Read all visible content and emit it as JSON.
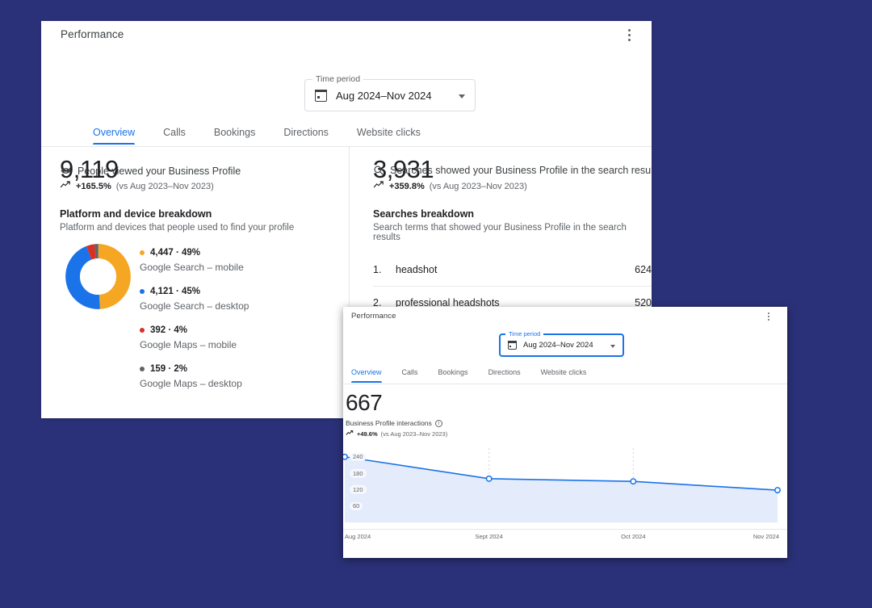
{
  "theme": {
    "desktop_bg": "#2b3178",
    "accent_blue": "#1a73e8",
    "orange": "#f5a623",
    "blue": "#1a73e8",
    "red": "#d93025",
    "gray": "#5f6368"
  },
  "window_back": {
    "title": "Performance",
    "menu_icon": "kebab-menu-icon",
    "time_period": {
      "legend": "Time period",
      "value": "Aug 2024–Nov 2024",
      "icon": "calendar-icon",
      "caret": "chevron-down-icon"
    },
    "tabs": [
      {
        "label": "Overview",
        "active": true
      },
      {
        "label": "Calls",
        "active": false
      },
      {
        "label": "Bookings",
        "active": false
      },
      {
        "label": "Directions",
        "active": false
      },
      {
        "label": "Website clicks",
        "active": false
      }
    ],
    "left_panel": {
      "value": "9,119",
      "metric_icon": "eye-icon",
      "metric_label": "People viewed your Business Profile",
      "trend_icon": "trending-up-icon",
      "trend_value": "+165.5%",
      "trend_compare": "(vs Aug 2023–Nov 2023)",
      "section_title": "Platform and device breakdown",
      "section_subtitle": "Platform and devices that people used to find your profile",
      "breakdown": [
        {
          "value": "4,447",
          "percent": "49%",
          "label": "Google Search – mobile",
          "color": "#f5a623",
          "share": 49
        },
        {
          "value": "4,121",
          "percent": "45%",
          "label": "Google Search – desktop",
          "color": "#1a73e8",
          "share": 45
        },
        {
          "value": "392",
          "percent": "4%",
          "label": "Google Maps – mobile",
          "color": "#d93025",
          "share": 4
        },
        {
          "value": "159",
          "percent": "2%",
          "label": "Google Maps – desktop",
          "color": "#5f6368",
          "share": 2
        }
      ]
    },
    "right_panel": {
      "value": "3,931",
      "metric_icon": "search-icon",
      "metric_label": "Searches showed your Business Profile in the search results",
      "trend_icon": "trending-up-icon",
      "trend_value": "+359.8%",
      "trend_compare": "(vs Aug 2023–Nov 2023)",
      "section_title": "Searches breakdown",
      "section_subtitle": "Search terms that showed your Business Profile in the search results",
      "terms": [
        {
          "rank": "1.",
          "name": "headshot",
          "count": "624"
        },
        {
          "rank": "2.",
          "name": "professional headshots",
          "count": "520"
        }
      ]
    }
  },
  "window_front": {
    "title": "Performance",
    "menu_icon": "kebab-menu-icon",
    "time_period": {
      "legend": "Time period",
      "value": "Aug 2024–Nov 2024",
      "icon": "calendar-icon",
      "caret": "chevron-down-icon",
      "focused": true
    },
    "tabs": [
      {
        "label": "Overview",
        "active": true
      },
      {
        "label": "Calls",
        "active": false
      },
      {
        "label": "Bookings",
        "active": false
      },
      {
        "label": "Directions",
        "active": false
      },
      {
        "label": "Website clicks",
        "active": false
      }
    ],
    "metric": {
      "value": "667",
      "label": "Business Profile interactions",
      "info_icon": "info-icon",
      "info_glyph": "i",
      "trend_icon": "trending-up-icon",
      "trend_value": "+49.6%",
      "trend_compare": "(vs Aug 2023–Nov 2023)"
    }
  },
  "chart_data": {
    "type": "line",
    "title": "Business Profile interactions",
    "xlabel": "",
    "ylabel": "",
    "x": [
      "Aug 2024",
      "Sept 2024",
      "Oct 2024",
      "Nov 2024"
    ],
    "values": [
      240,
      160,
      150,
      118
    ],
    "ytick_labels": [
      "240",
      "180",
      "120",
      "60"
    ],
    "ytick_values": [
      240,
      180,
      120,
      60
    ],
    "ylim": [
      0,
      260
    ],
    "grid": true,
    "legend": "none",
    "line_color": "#1a73e8",
    "fill_color": "#e4ebfb",
    "marker": "open-circle"
  }
}
